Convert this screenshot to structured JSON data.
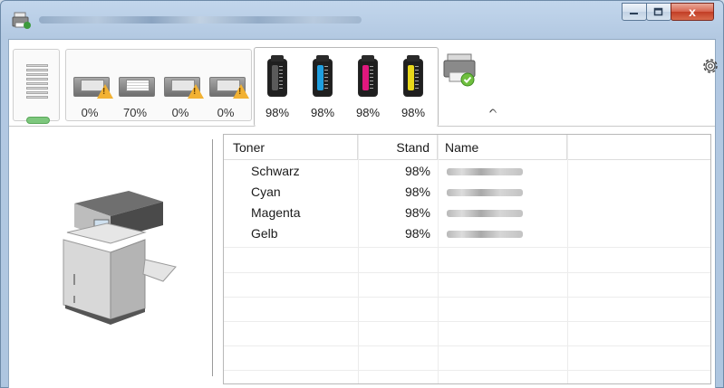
{
  "window": {
    "title": "",
    "controls": [
      "minimize",
      "maximize",
      "close"
    ],
    "close_glyph": "x"
  },
  "toolbar": {
    "status_icon": "paper-stack-icon",
    "trays": [
      {
        "icon": "paper-tray-icon",
        "warning": true,
        "level": "0%"
      },
      {
        "icon": "paper-tray-icon",
        "warning": false,
        "level": "70%"
      },
      {
        "icon": "paper-tray-icon",
        "warning": true,
        "level": "0%"
      },
      {
        "icon": "paper-tray-icon",
        "warning": true,
        "level": "0%"
      }
    ],
    "toners": [
      {
        "color": "#1c1c1c",
        "level": "98%"
      },
      {
        "color": "#1f9fe0",
        "level": "98%"
      },
      {
        "color": "#e0187e",
        "level": "98%"
      },
      {
        "color": "#e8d81a",
        "level": "98%"
      }
    ],
    "device_icon": "printer-check-icon",
    "collapse_glyph": "ᨈ",
    "settings_icon": "gear-icon"
  },
  "table": {
    "columns": [
      "Toner",
      "Stand",
      "Name"
    ],
    "rows": [
      {
        "toner": "Schwarz",
        "stand": "98%"
      },
      {
        "toner": "Cyan",
        "stand": "98%"
      },
      {
        "toner": "Magenta",
        "stand": "98%"
      },
      {
        "toner": "Gelb",
        "stand": "98%"
      }
    ]
  },
  "colors": {
    "status_ok": "#7dc77d",
    "warning": "#f2b233",
    "close_button": "#c23d25"
  }
}
